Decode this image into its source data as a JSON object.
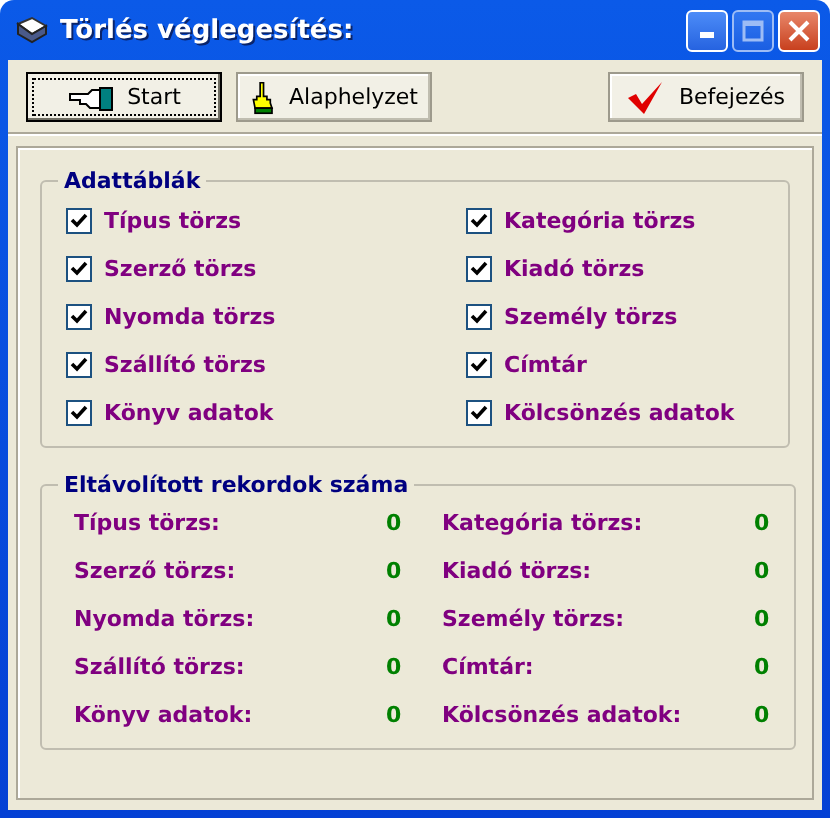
{
  "window": {
    "title": "Törlés véglegesítés:"
  },
  "toolbar": [
    {
      "kind": "start",
      "label": "Start",
      "focused": true
    },
    {
      "kind": "reset",
      "label": "Alaphelyzet",
      "focused": false
    },
    {
      "kind": "finish",
      "label": "Befejezés",
      "focused": false
    }
  ],
  "tables": {
    "title": "Adattáblák",
    "items": [
      {
        "label": "Típus törzs",
        "checked": true
      },
      {
        "label": "Kategória törzs",
        "checked": true
      },
      {
        "label": "Szerző törzs",
        "checked": true
      },
      {
        "label": "Kiadó törzs",
        "checked": true
      },
      {
        "label": "Nyomda törzs",
        "checked": true
      },
      {
        "label": "Személy törzs",
        "checked": true
      },
      {
        "label": "Szállító törzs",
        "checked": true
      },
      {
        "label": "Címtár",
        "checked": true
      },
      {
        "label": "Könyv adatok",
        "checked": true
      },
      {
        "label": "Kölcsönzés adatok",
        "checked": true
      }
    ]
  },
  "removed": {
    "title": "Eltávolított rekordok száma",
    "items": [
      {
        "label": "Típus törzs:",
        "value": "0"
      },
      {
        "label": "Kategória törzs:",
        "value": "0"
      },
      {
        "label": "Szerző törzs:",
        "value": "0"
      },
      {
        "label": "Kiadó törzs:",
        "value": "0"
      },
      {
        "label": "Nyomda törzs:",
        "value": "0"
      },
      {
        "label": "Személy törzs:",
        "value": "0"
      },
      {
        "label": "Szállító törzs:",
        "value": "0"
      },
      {
        "label": "Címtár:",
        "value": "0"
      },
      {
        "label": "Könyv adatok:",
        "value": "0"
      },
      {
        "label": "Kölcsönzés adatok:",
        "value": "0"
      }
    ]
  }
}
